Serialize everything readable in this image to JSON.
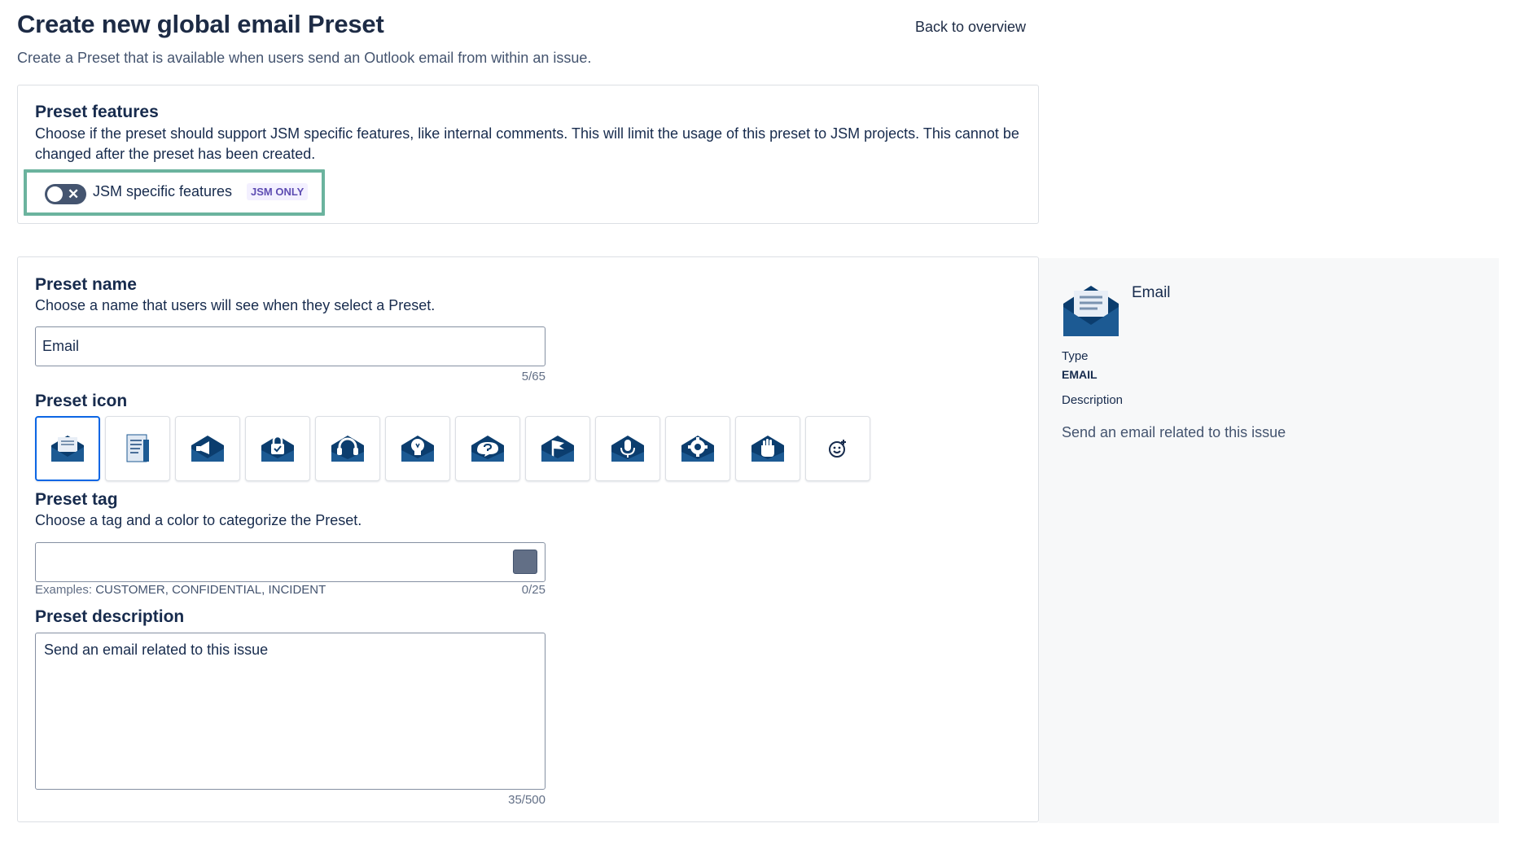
{
  "header": {
    "title": "Create new global email Preset",
    "subtitle": "Create a Preset that is available when users send an Outlook email from within an issue.",
    "back_link": "Back to overview"
  },
  "features": {
    "title": "Preset features",
    "description": "Choose if the preset should support JSM specific features, like internal comments. This will limit the usage of this preset to JSM projects. This cannot be changed after the preset has been created.",
    "toggle_label": "JSM specific features",
    "toggle_state": "off",
    "badge": "JSM ONLY"
  },
  "name": {
    "title": "Preset name",
    "description": "Choose a name that users will see when they select a Preset.",
    "value": "Email",
    "counter": "5/65"
  },
  "icon": {
    "title": "Preset icon",
    "options": [
      "envelope-letter-icon",
      "document-icon",
      "envelope-megaphone-icon",
      "envelope-lock-icon",
      "envelope-headset-icon",
      "envelope-lightbulb-icon",
      "envelope-question-icon",
      "envelope-flag-icon",
      "envelope-microphone-icon",
      "envelope-gear-icon",
      "envelope-hand-icon",
      "add-emoji-icon"
    ],
    "selected_index": 0
  },
  "tag": {
    "title": "Preset tag",
    "description": "Choose a tag and a color to categorize the Preset.",
    "value": "",
    "color": "#626f86",
    "examples_prefix": "Examples:",
    "examples": "CUSTOMER, CONFIDENTIAL, INCIDENT",
    "counter": "0/25"
  },
  "description": {
    "title": "Preset description",
    "value": "Send an email related to this issue",
    "counter": "35/500"
  },
  "preview": {
    "name": "Email",
    "type_label": "Type",
    "type_value": "EMAIL",
    "description_label": "Description",
    "description_value": "Send an email related to this issue"
  },
  "colors": {
    "accent": "#0c66e4",
    "highlight": "#6bb39e",
    "envelope_dark": "#0b3d6e",
    "envelope_mid": "#1c5a93"
  }
}
